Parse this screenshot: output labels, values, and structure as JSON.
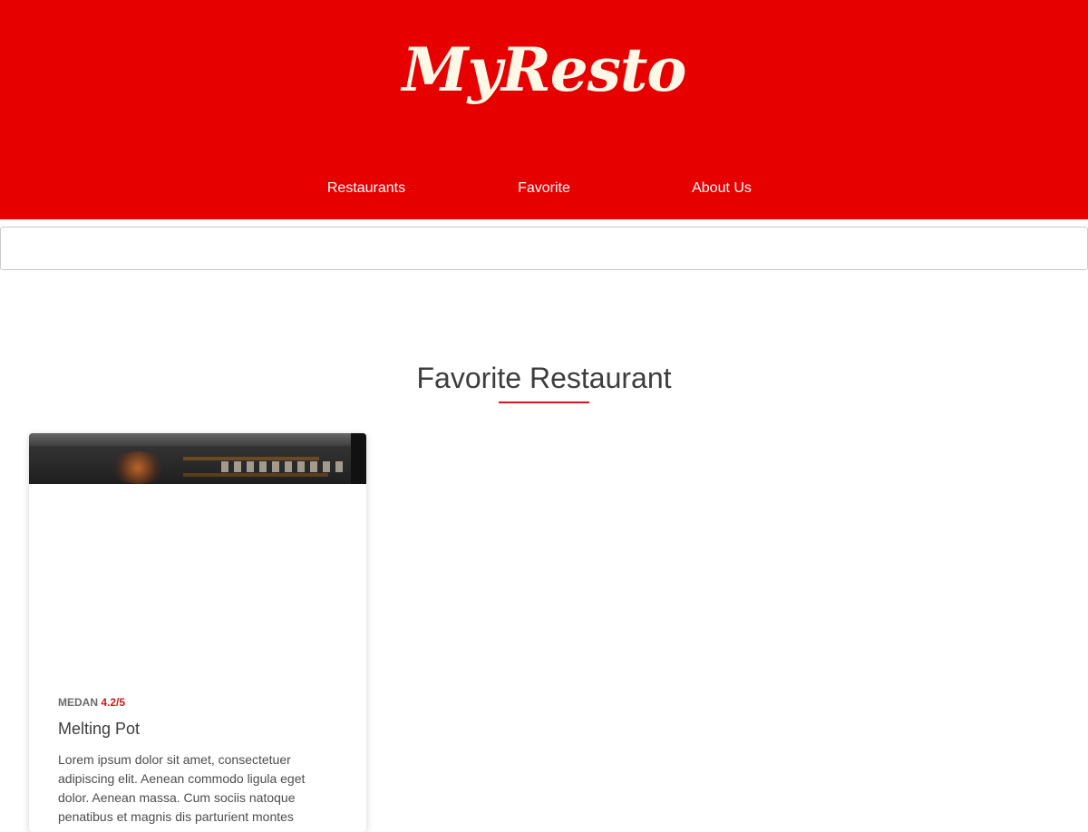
{
  "header": {
    "logo_text": "MyResto",
    "nav": [
      {
        "label": "Restaurants"
      },
      {
        "label": "Favorite"
      },
      {
        "label": "About Us"
      }
    ]
  },
  "search": {
    "value": "",
    "placeholder": ""
  },
  "main": {
    "section_title": "Favorite Restaurant",
    "restaurants": [
      {
        "city": "MEDAN",
        "rating": "4.2/5",
        "name": "Melting Pot",
        "description": "Lorem ipsum dolor sit amet, consectetuer adipiscing elit. Aenean commodo ligula eget dolor. Aenean massa. Cum sociis natoque penatibus et magnis dis parturient montes"
      }
    ]
  },
  "colors": {
    "brand_red": "#e60000",
    "accent_red": "#d11a1a",
    "logo_cream": "#fff8e6",
    "title_gray": "#3d3d3d"
  }
}
